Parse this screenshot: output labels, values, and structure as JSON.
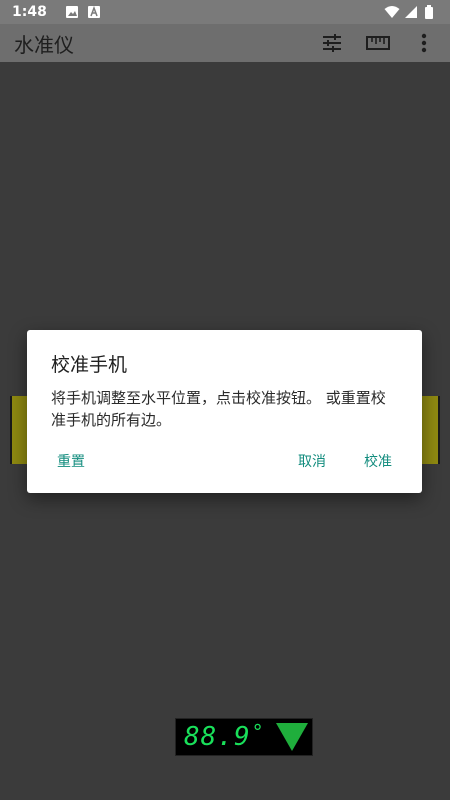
{
  "status_bar": {
    "time": "1:48",
    "left_icons": [
      "image-icon",
      "a-box-icon"
    ],
    "right_icons": [
      "wifi-icon",
      "signal-icon",
      "battery-icon"
    ]
  },
  "app_bar": {
    "title": "水准仪",
    "actions": [
      "tune-icon",
      "ruler-icon",
      "more-vert-icon"
    ]
  },
  "dialog": {
    "title": "校准手机",
    "message": "将手机调整至水平位置，点击校准按钮。 或重置校准手机的所有边。",
    "reset_label": "重置",
    "cancel_label": "取消",
    "calibrate_label": "校准"
  },
  "display": {
    "value": "88.9",
    "unit": "°",
    "direction_icon": "arrow-down-icon"
  },
  "colors": {
    "accent": "#128c7e",
    "digit": "#19e05a",
    "tube": "#8f8a11"
  }
}
